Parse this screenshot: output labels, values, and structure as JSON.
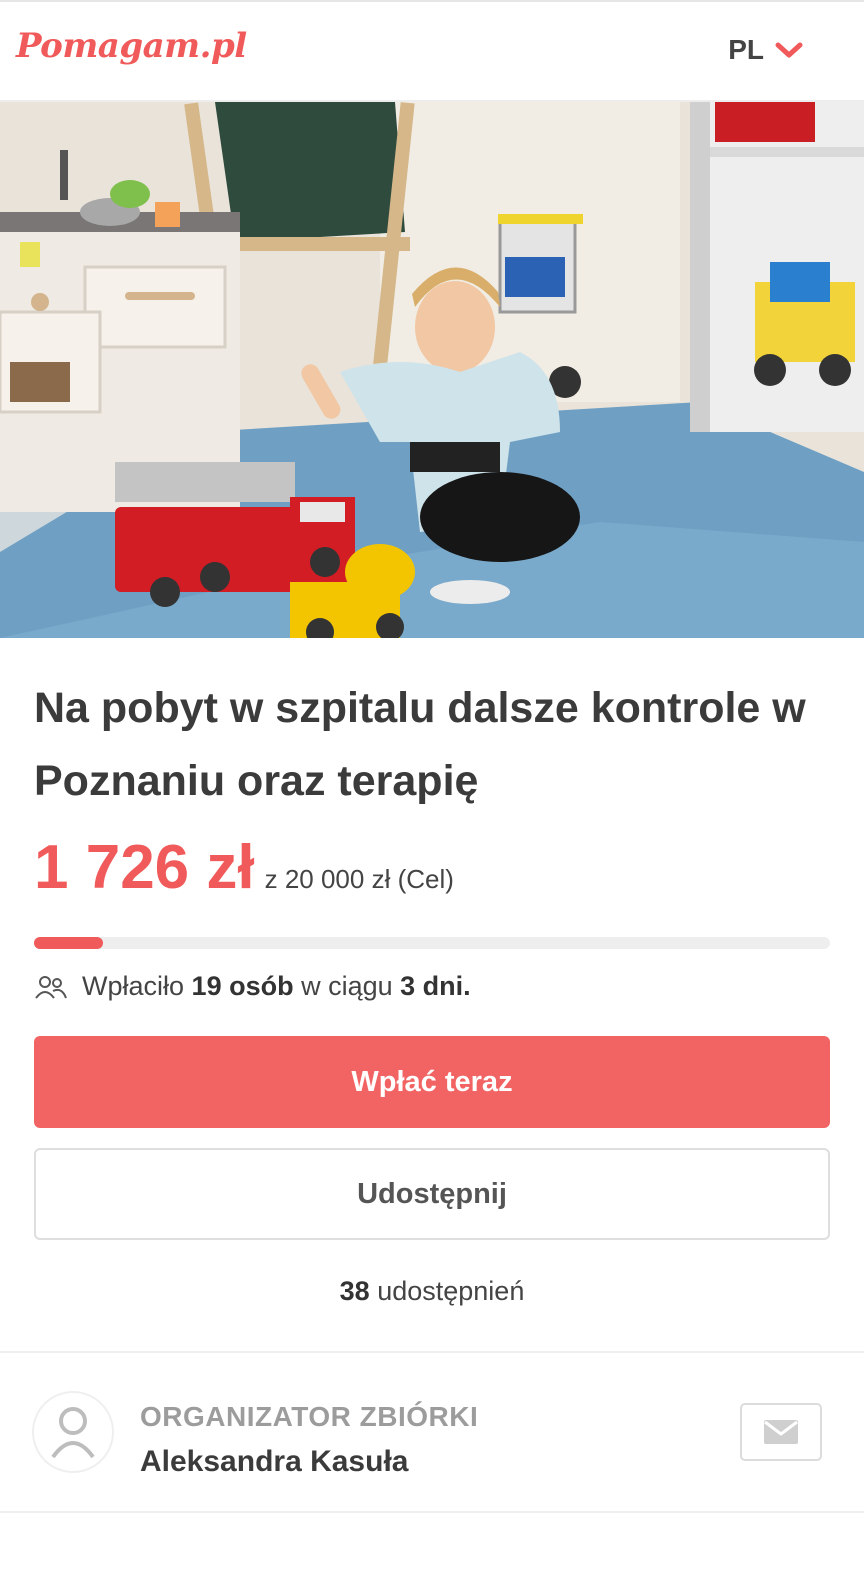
{
  "header": {
    "logo_text": "Pomagam.pl",
    "language": "PL",
    "language_icon": "chevron-down-icon"
  },
  "hero": {
    "image_description_icon": "campaign-photo"
  },
  "campaign": {
    "title": "Na pobyt w szpitalu dalsze kontrole w Poznaniu oraz terapię",
    "amount": "1 726 zł",
    "goal": "z 20 000 zł (Cel)",
    "progress_fraction": 0.0863,
    "donors_prefix": "Wpłaciło",
    "donors_count": "19 osób",
    "donors_middle": "w ciągu",
    "donors_days": "3 dni.",
    "donate_label": "Wpłać teraz",
    "share_label": "Udostępnij",
    "shares_count": "38",
    "shares_label": "udostępnień"
  },
  "organizer": {
    "label": "ORGANIZATOR ZBIÓRKI",
    "name": "Aleksandra Kasuła",
    "avatar_icon": "user-icon",
    "message_icon": "mail-icon"
  },
  "colors": {
    "brand": "#f05a5a",
    "button": "#f26464"
  }
}
